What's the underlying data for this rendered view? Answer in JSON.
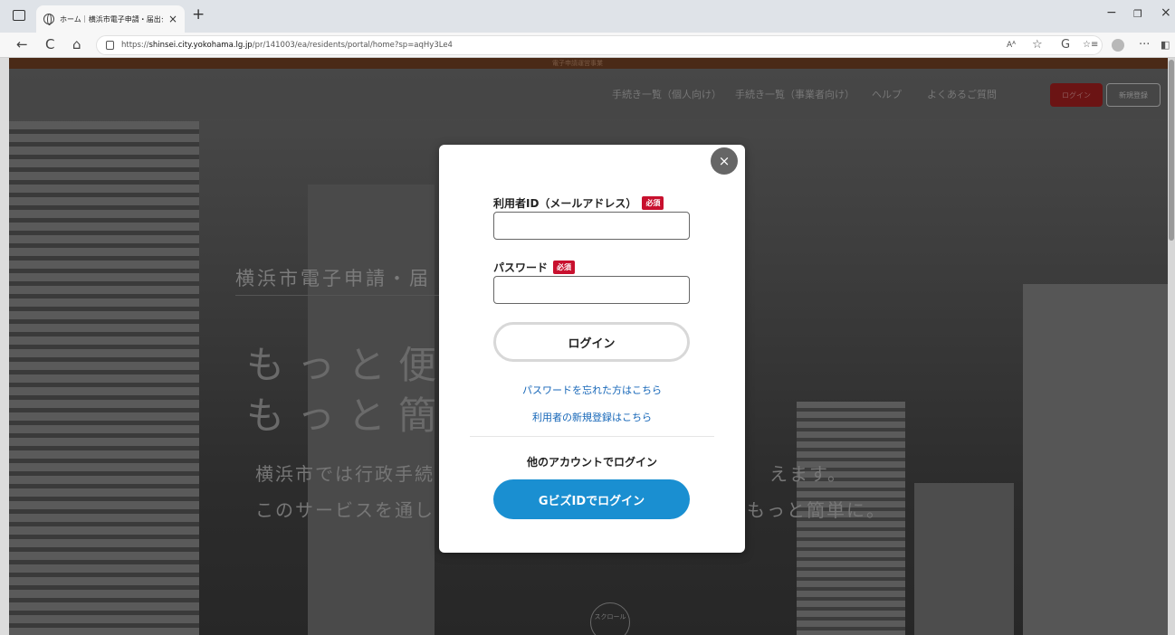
{
  "browser": {
    "tab_title": "ホーム｜横浜市電子申請・届出シ",
    "tab_close": "×",
    "new_tab": "+",
    "url_scheme": "https://",
    "url_host": "shinsei.city.yokohama.lg.jp",
    "url_path": "/pr/141003/ea/residents/portal/home?sp=aqHy3Le4",
    "nav": {
      "back": "←",
      "refresh": "C",
      "home": "⌂"
    },
    "right_icons": {
      "read_aloud": "Aᴬ",
      "favorite": "☆",
      "copilot": "G",
      "collections": "☆≡",
      "more": "···",
      "sidebar": "◧"
    },
    "window": {
      "minimize": "−",
      "restore": "❐",
      "close": "×"
    }
  },
  "page": {
    "top_strip_text": "電子申請運営事業",
    "header_nav": [
      "手続き一覧（個人向け）",
      "手続き一覧（事業者向け）",
      "ヘルプ",
      "よくあるご質問"
    ],
    "header_login": "ログイン",
    "header_register": "新規登録",
    "hero_title": "横浜市電子申請・届",
    "hero_line2": "もっと便",
    "hero_line3": "もっと簡",
    "hero_text1": "横浜市では行政手続",
    "hero_text2": "このサービスを通し",
    "hero_text1_right": "えます。",
    "hero_text2_right": "もっと簡単に。",
    "scroll_label": "スクロール"
  },
  "modal": {
    "close_label": "×",
    "user_id_label": "利用者ID（メールアドレス）",
    "required_badge": "必須",
    "user_id_value": "",
    "password_label": "パスワード",
    "password_value": "",
    "login_button": "ログイン",
    "forgot_password_link": "パスワードを忘れた方はこちら",
    "register_link": "利用者の新規登録はこちら",
    "other_account_title": "他のアカウントでログイン",
    "gbiz_button": "GビズIDでログイン"
  },
  "colors": {
    "required_badge": "#c8102e",
    "link": "#1566b8",
    "gbiz_button": "#1a8fd1",
    "header_login_button": "#6b1414"
  }
}
